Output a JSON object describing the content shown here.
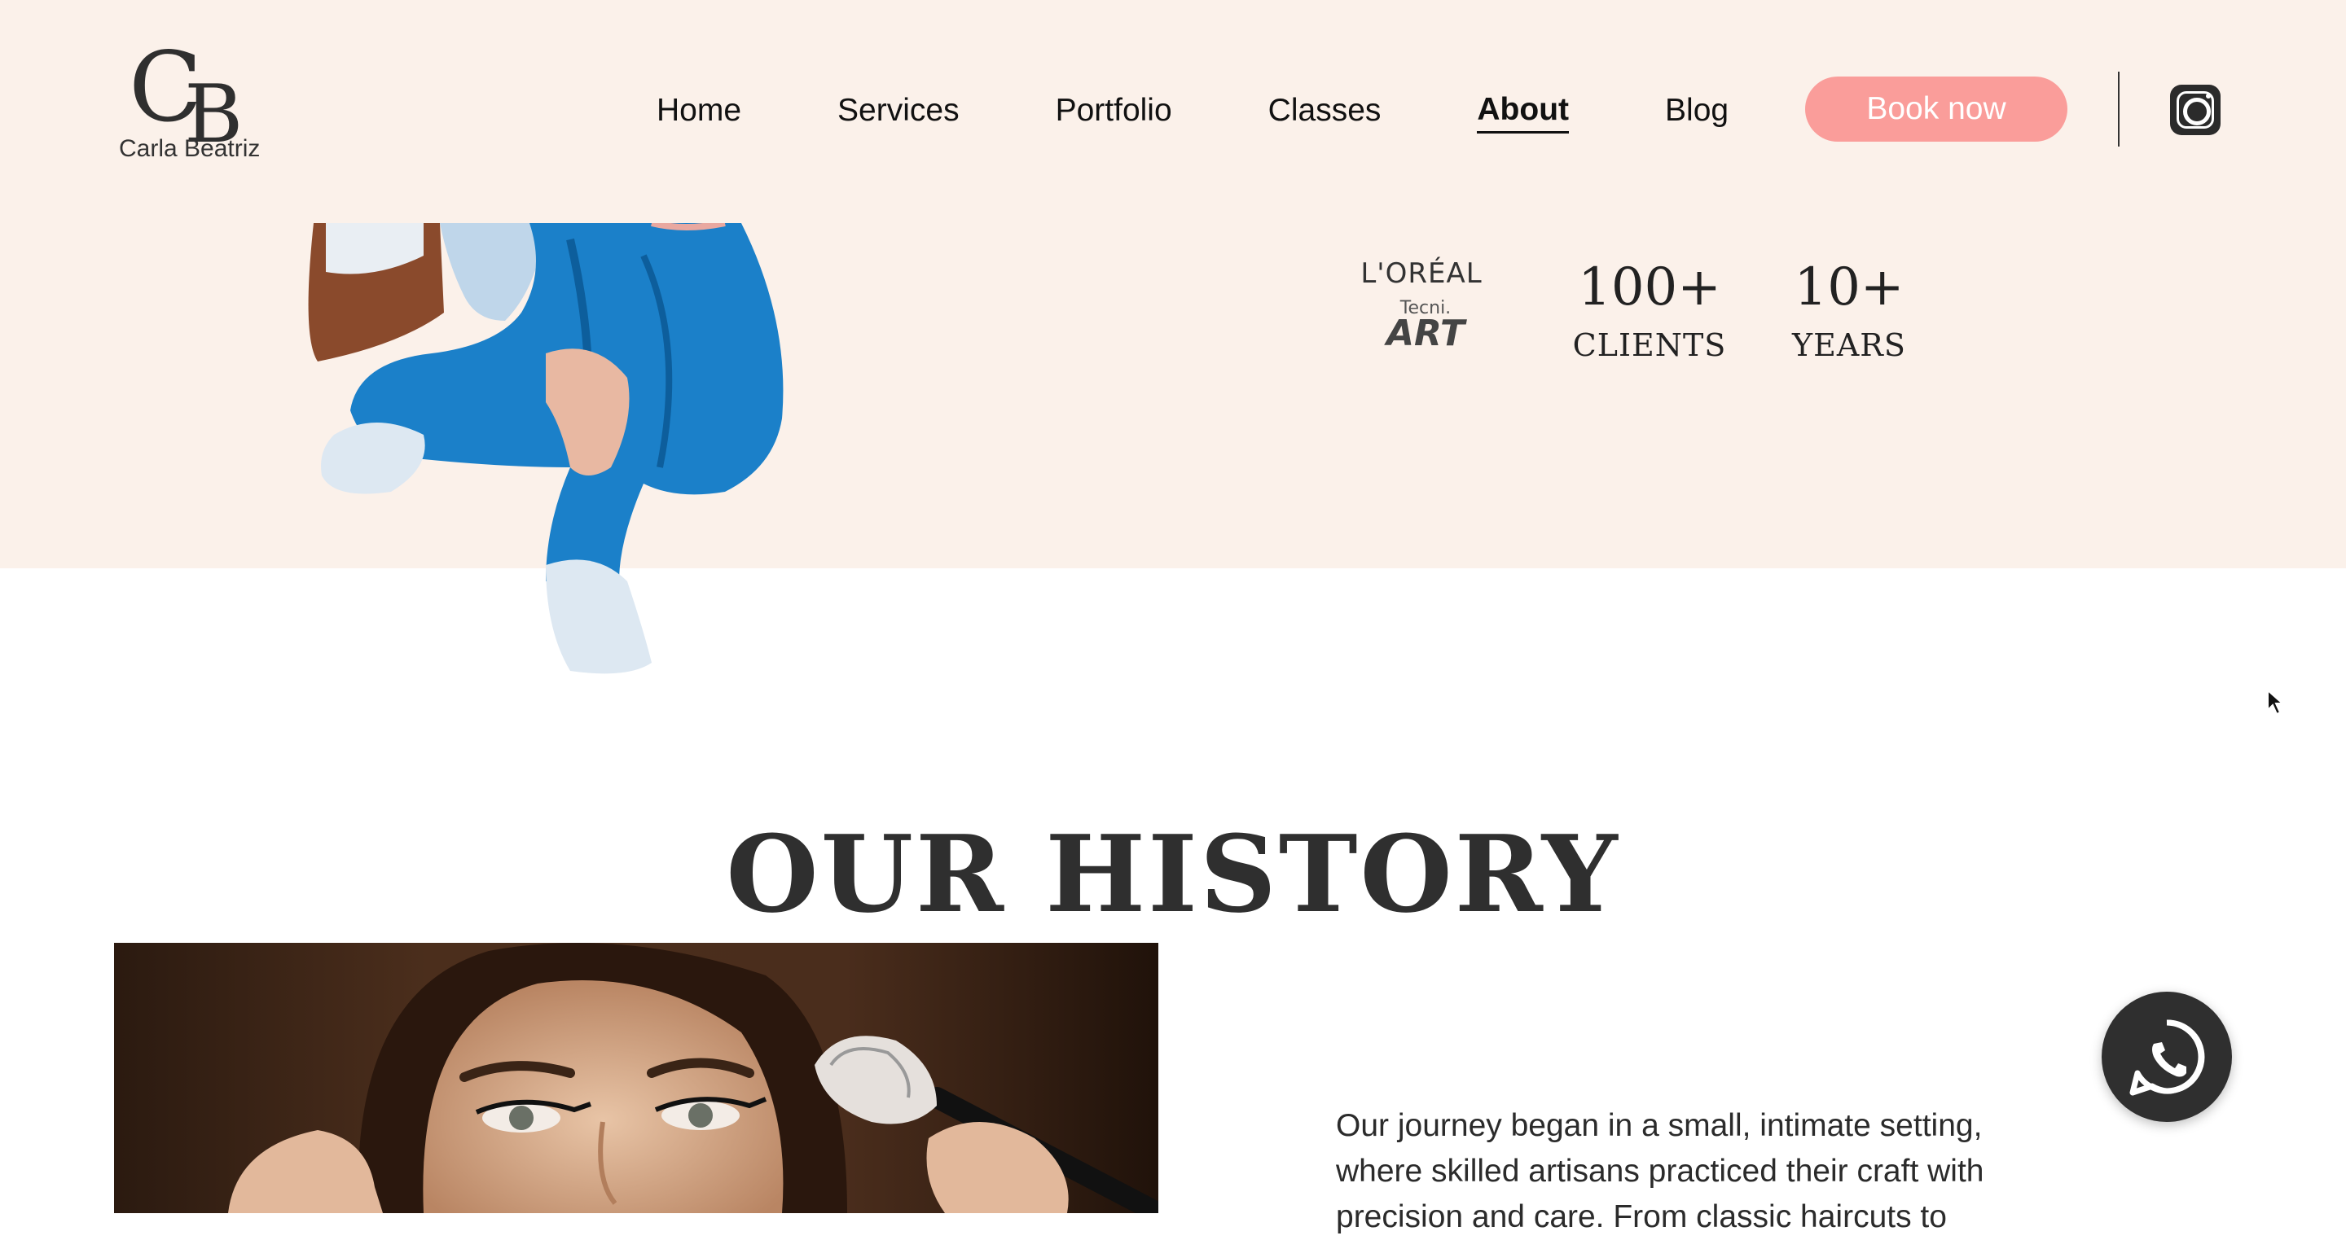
{
  "brand": {
    "monogram_c": "C",
    "monogram_b": "B",
    "name": "Carla Beatriz"
  },
  "nav": {
    "items": [
      {
        "label": "Home"
      },
      {
        "label": "Services"
      },
      {
        "label": "Portfolio"
      },
      {
        "label": "Classes"
      },
      {
        "label": "About",
        "active": true
      },
      {
        "label": "Blog"
      }
    ],
    "cta_label": "Book now",
    "cta_color": "#fa9d9a"
  },
  "partners": {
    "loreal": "L'ORÉAL",
    "tecni_small": "Tecni.",
    "tecni_big": "ART"
  },
  "stats": [
    {
      "value": "100+",
      "label": "CLIENTS"
    },
    {
      "value": "10+",
      "label": "YEARS"
    }
  ],
  "history": {
    "title": "OUR HISTORY",
    "text": "Our journey began in a small, intimate setting, where skilled artisans practiced their craft with precision and care. From classic haircuts to"
  },
  "icons": {
    "social": "instagram-icon",
    "chat": "whatsapp-icon",
    "pointer": "mouse-cursor-icon"
  },
  "colors": {
    "header_bg": "#fbf1ea",
    "text": "#2b2b2b",
    "accent": "#fa9d9a"
  }
}
